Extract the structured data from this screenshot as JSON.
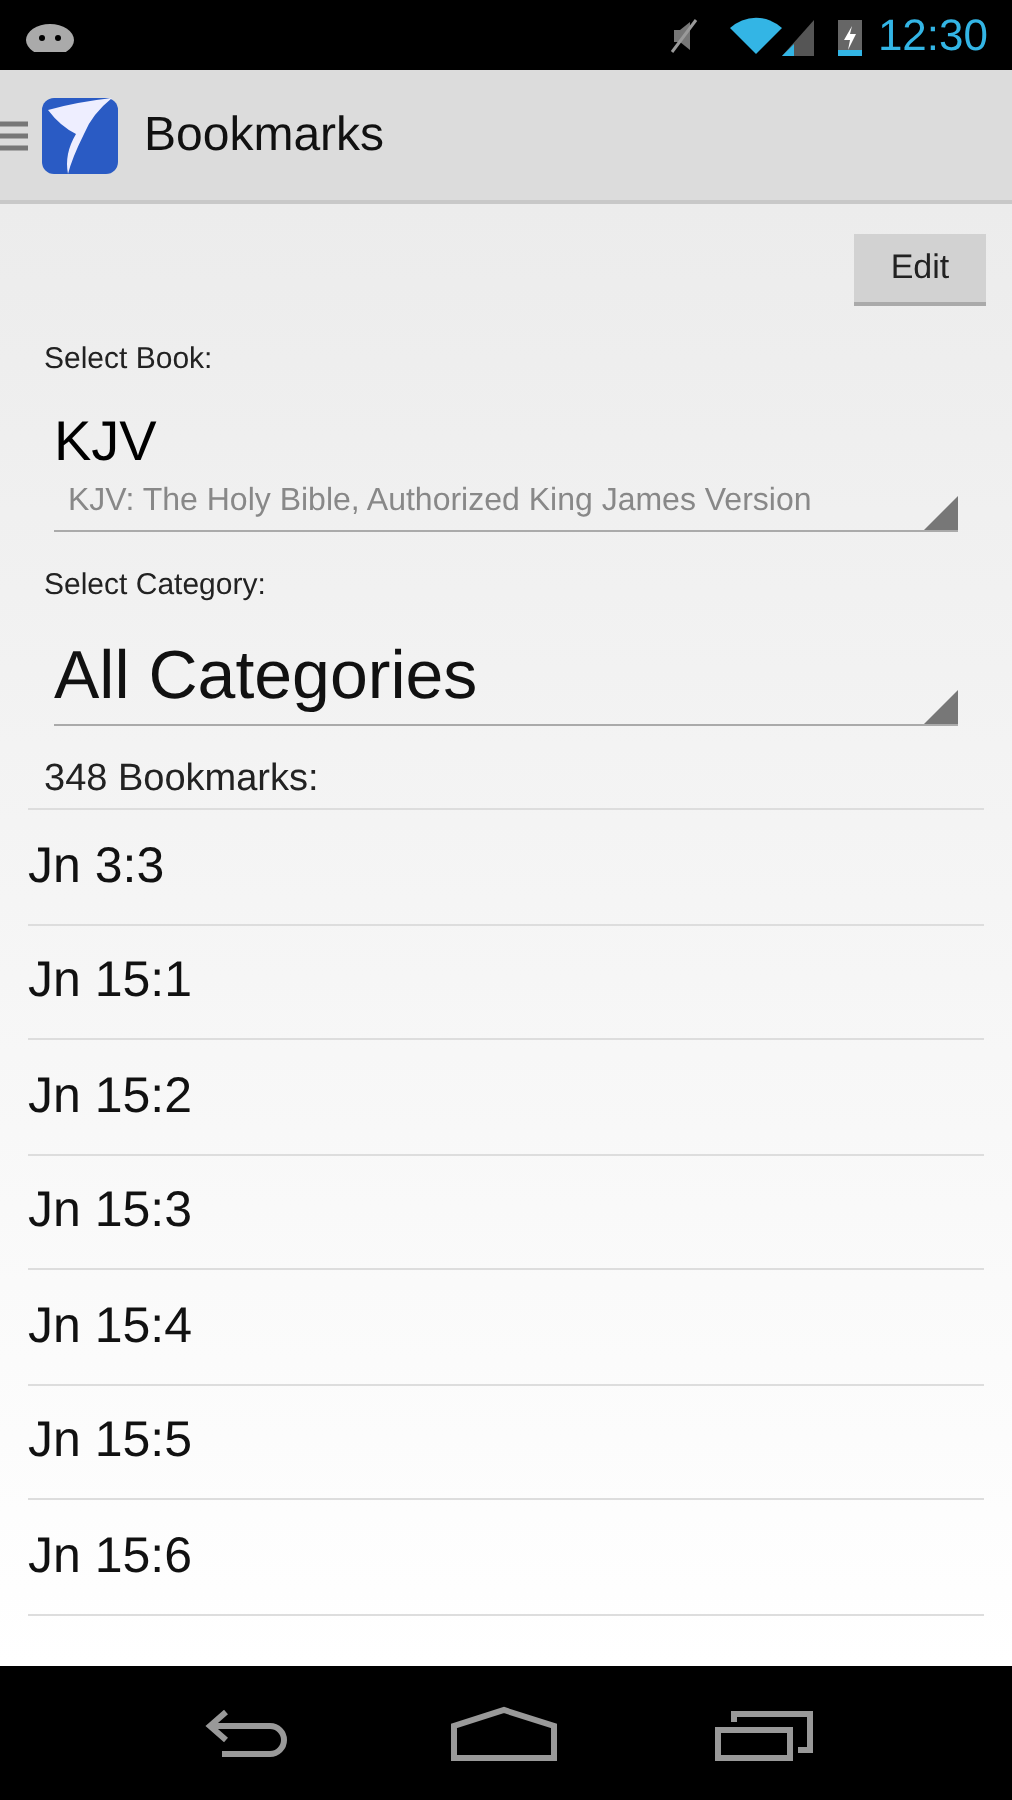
{
  "status_bar": {
    "time": "12:30"
  },
  "action_bar": {
    "title": "Bookmarks"
  },
  "edit_button": "Edit",
  "book": {
    "label": "Select Book:",
    "value": "KJV",
    "description": "KJV: The Holy Bible, Authorized King James Version"
  },
  "category": {
    "label": "Select Category:",
    "value": "All Categories"
  },
  "count": "348 Bookmarks:",
  "bookmarks": [
    "Jn 3:3",
    "Jn 15:1",
    "Jn 15:2",
    "Jn 15:3",
    "Jn 15:4",
    "Jn 15:5",
    "Jn 15:6"
  ]
}
